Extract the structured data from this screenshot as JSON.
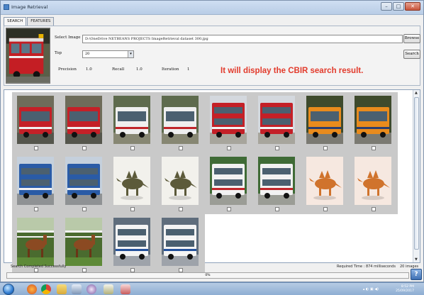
{
  "window": {
    "title": "Image Retrieval",
    "controls": [
      "–",
      "□",
      "✕"
    ]
  },
  "tabs": [
    {
      "label": "SEARCH",
      "active": true
    },
    {
      "label": "FEATURES",
      "active": false
    }
  ],
  "search": {
    "select_image_label": "Select Image",
    "path_value": "D:\\OneDrive NETBEANS PROJECTS ImageRetrieval dataset 300.jpg",
    "browse_label": "Browse",
    "top_label": "Top",
    "top_value": "20",
    "search_label": "Search",
    "precision_label": "Precision",
    "precision_value": "1.0",
    "recall_label": "Recall",
    "recall_value": "1.0",
    "iteration_label": "Iteration",
    "iteration_value": "1"
  },
  "notice": "It will display the CBIR search result.",
  "results": [
    {
      "image": "red-bus",
      "checked": false
    },
    {
      "image": "red-bus",
      "checked": false
    },
    {
      "image": "white-red-bus",
      "checked": false
    },
    {
      "image": "white-red-bus",
      "checked": false
    },
    {
      "image": "red-white-double-decker",
      "checked": false
    },
    {
      "image": "red-white-double-decker",
      "checked": false
    },
    {
      "image": "orange-bus",
      "checked": false
    },
    {
      "image": "orange-bus",
      "checked": false
    },
    {
      "image": "blue-double-decker",
      "checked": false
    },
    {
      "image": "blue-double-decker",
      "checked": false
    },
    {
      "image": "dinosaur-dark",
      "checked": false
    },
    {
      "image": "dinosaur-dark",
      "checked": false
    },
    {
      "image": "white-coach-trees",
      "checked": false
    },
    {
      "image": "white-coach-trees",
      "checked": false
    },
    {
      "image": "dinosaur-orange",
      "checked": false
    },
    {
      "image": "dinosaur-orange",
      "checked": false
    },
    {
      "image": "horse",
      "checked": false
    },
    {
      "image": "horse",
      "checked": false
    },
    {
      "image": "white-blue-double-decker",
      "checked": false
    },
    {
      "image": "white-blue-double-decker",
      "checked": false
    }
  ],
  "status": {
    "message": "Search Completed Successfully",
    "required_time": "Required Time : 874 milliseconds",
    "result_count": "20 images"
  },
  "progress": {
    "text": "0%",
    "value": 0
  },
  "taskbar": {
    "icons": [
      "start-orb-icon",
      "firefox-icon",
      "chrome-icon",
      "file-explorer-icon",
      "virtualbox-icon",
      "media-icon",
      "tool-icon",
      "java-app-icon"
    ],
    "time": "8:52 PM",
    "date": "25/09/2017"
  }
}
